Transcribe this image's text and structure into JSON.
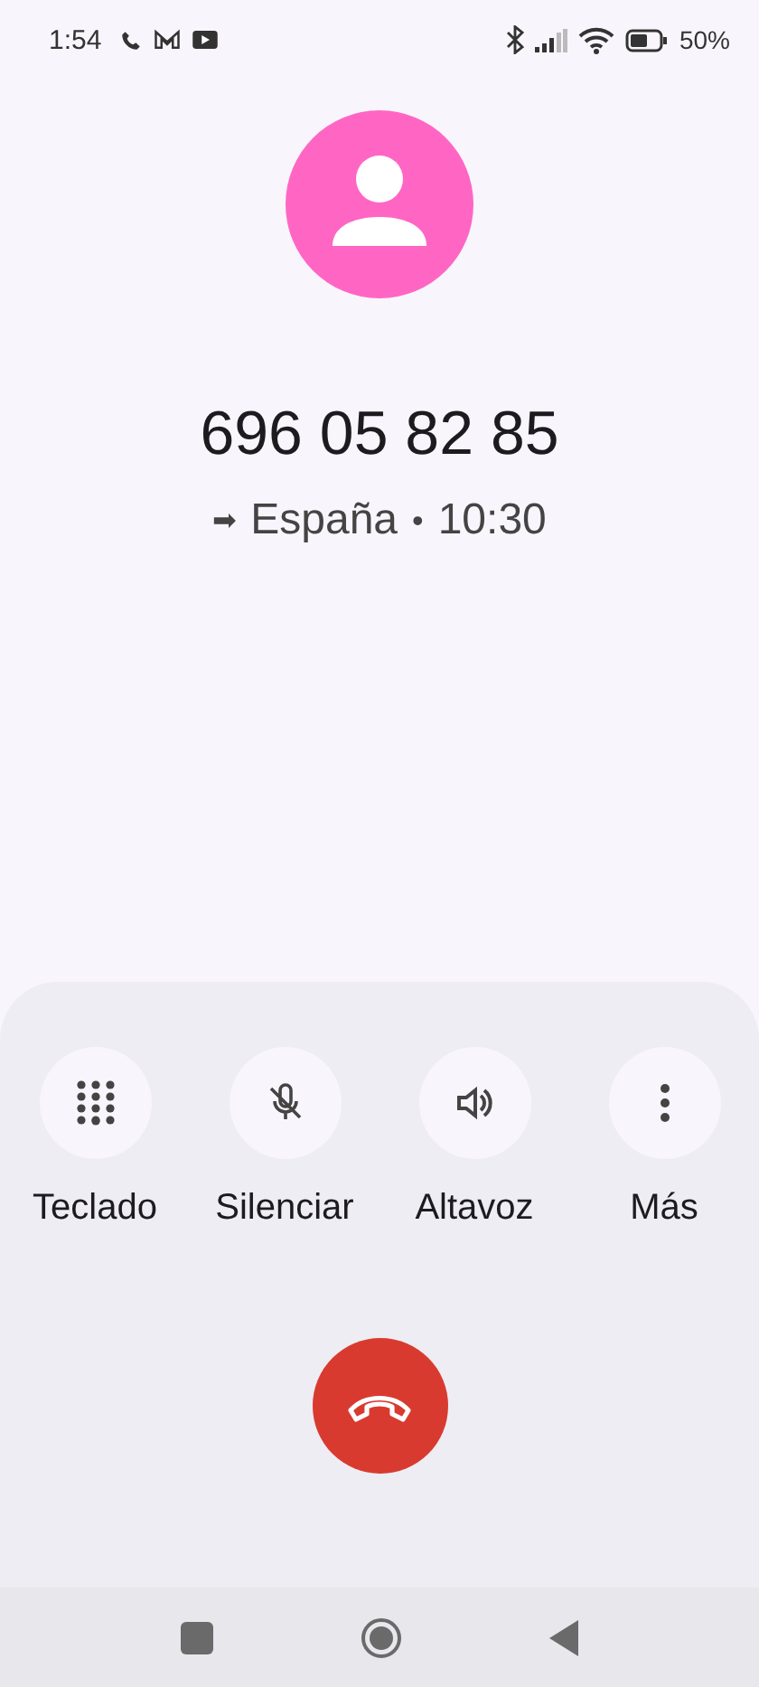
{
  "status_bar": {
    "time": "1:54",
    "battery": "50%"
  },
  "caller": {
    "number": "696 05 82 85",
    "direction_icon": "➡",
    "location": "España",
    "separator": "•",
    "duration": "10:30"
  },
  "controls": [
    {
      "kind": "keypad",
      "label": "Teclado"
    },
    {
      "kind": "mute",
      "label": "Silenciar"
    },
    {
      "kind": "speaker",
      "label": "Altavoz"
    },
    {
      "kind": "more",
      "label": "Más"
    }
  ]
}
